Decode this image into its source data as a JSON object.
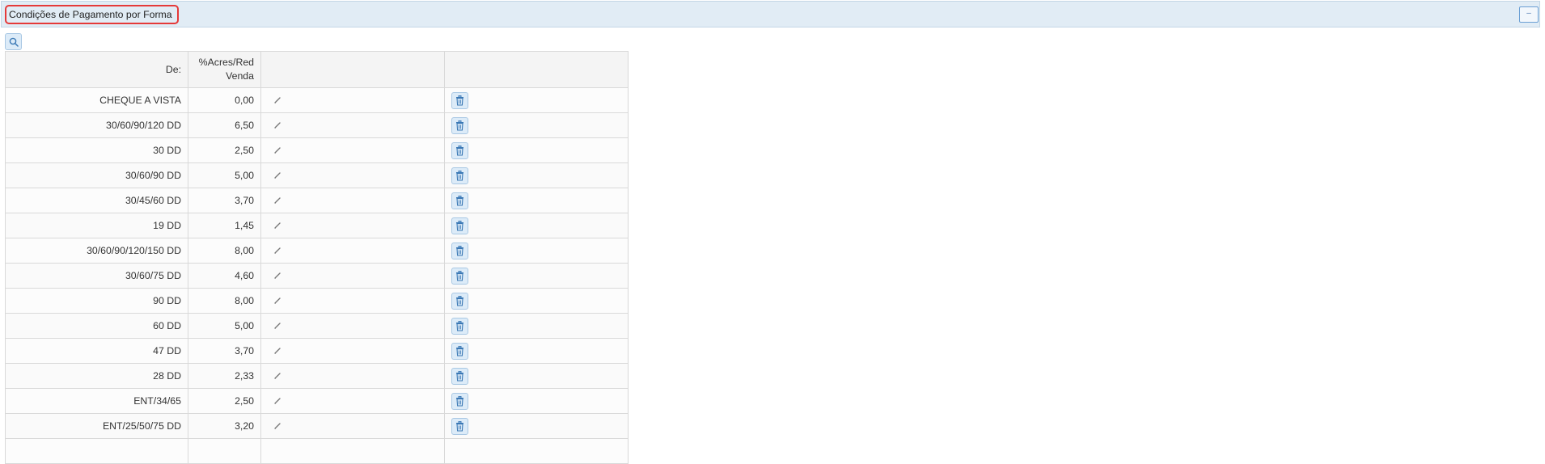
{
  "panel": {
    "title": "Condições de Pagamento por Forma",
    "collapse_label": "–"
  },
  "table": {
    "headers": [
      "De:",
      "%Acres/Red Venda",
      "",
      ""
    ],
    "rows": [
      {
        "de": "CHEQUE A VISTA",
        "acres": "0,00"
      },
      {
        "de": "30/60/90/120 DD",
        "acres": "6,50"
      },
      {
        "de": "30 DD",
        "acres": "2,50"
      },
      {
        "de": "30/60/90 DD",
        "acres": "5,00"
      },
      {
        "de": "30/45/60 DD",
        "acres": "3,70"
      },
      {
        "de": "19 DD",
        "acres": "1,45"
      },
      {
        "de": "30/60/90/120/150 DD",
        "acres": "8,00"
      },
      {
        "de": "30/60/75 DD",
        "acres": "4,60"
      },
      {
        "de": "90 DD",
        "acres": "8,00"
      },
      {
        "de": "60 DD",
        "acres": "5,00"
      },
      {
        "de": "47 DD",
        "acres": "3,70"
      },
      {
        "de": "28 DD",
        "acres": "2,33"
      },
      {
        "de": "ENT/34/65",
        "acres": "2,50"
      },
      {
        "de": "ENT/25/50/75 DD",
        "acres": "3,20"
      },
      {
        "de": "",
        "acres": ""
      }
    ]
  },
  "icons": {
    "search": "search-icon",
    "edit": "pencil-icon",
    "delete": "trash-icon"
  },
  "colors": {
    "header_bg": "#e1ecf5",
    "title_outline": "#e53939",
    "button_bg": "#dcebf8",
    "icon_blue": "#3a78b5"
  }
}
